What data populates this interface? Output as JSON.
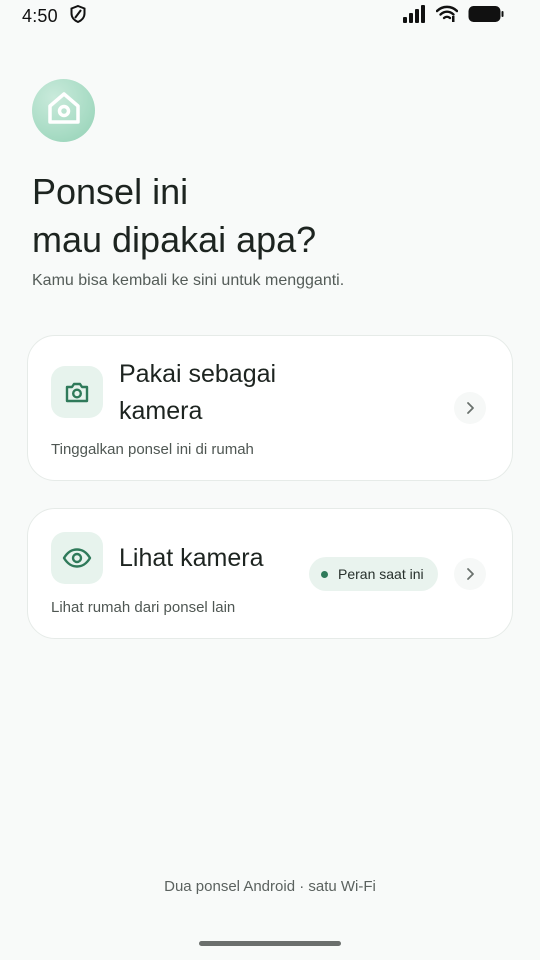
{
  "status_bar": {
    "time": "4:50",
    "left_icons": [
      "shield-icon"
    ],
    "right_icons": [
      "signal-icon",
      "wifi-icon",
      "battery-icon"
    ]
  },
  "header": {
    "logo_icon": "home-icon",
    "title_line1": "Ponsel ini",
    "title_line2": "mau dipakai apa?",
    "subtitle": "Kamu bisa kembali ke sini untuk mengganti."
  },
  "options": {
    "camera": {
      "icon": "camera-icon",
      "title": "Pakai sebagai kamera",
      "description": "Tinggalkan ponsel ini di rumah"
    },
    "viewer": {
      "icon": "eye-icon",
      "title": "Lihat kamera",
      "badge": "Peran saat ini",
      "description": "Lihat rumah dari ponsel lain"
    }
  },
  "footer": {
    "note": "Dua ponsel Android · satu Wi-Fi"
  },
  "colors": {
    "accent": "#2f7a5a",
    "icon_bg": "#e7f3ed",
    "logo_bg": "#a9dcc5",
    "background": "#f8faf9"
  }
}
